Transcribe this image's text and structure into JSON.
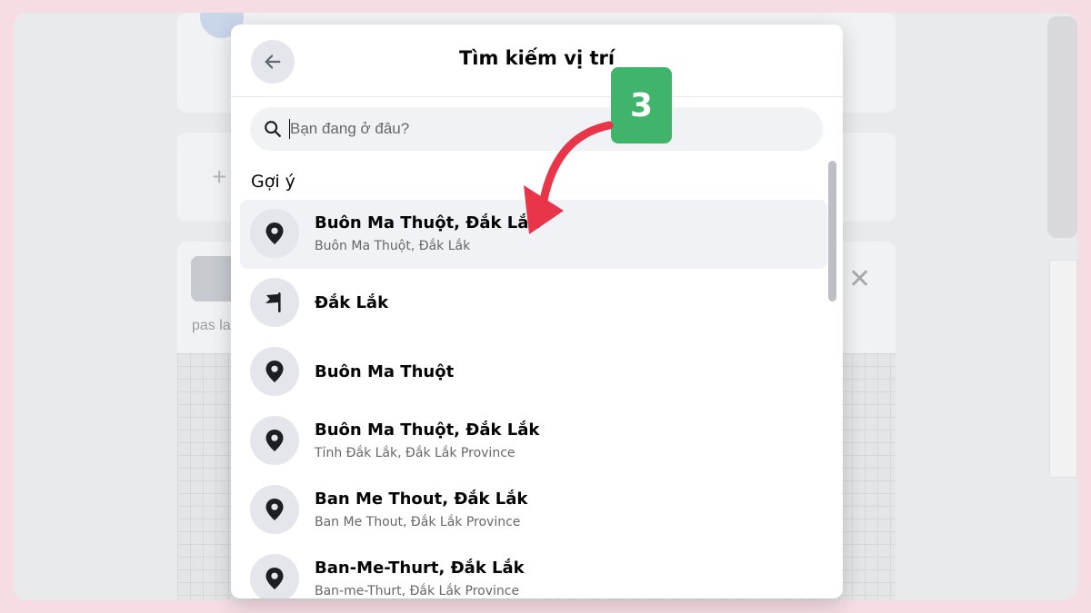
{
  "modal": {
    "title": "Tìm kiếm vị trí",
    "back_icon": "arrow-left-icon",
    "search": {
      "placeholder": "Bạn đang ở đâu?",
      "value": ""
    },
    "section_label": "Gợi ý",
    "suggestions": [
      {
        "icon": "map-pin-icon",
        "title": "Buôn Ma Thuột, Đắk Lắk",
        "subtitle": "Buôn Ma Thuột, Đắk Lắk",
        "active": true
      },
      {
        "icon": "flag-icon",
        "title": "Đắk Lắk",
        "subtitle": ""
      },
      {
        "icon": "map-pin-icon",
        "title": "Buôn Ma Thuột",
        "subtitle": ""
      },
      {
        "icon": "map-pin-icon",
        "title": "Buôn Ma Thuột, Đắk Lắk",
        "subtitle": "Tỉnh Đắk Lắk, Đắk Lắk Province"
      },
      {
        "icon": "map-pin-icon",
        "title": "Ban Me Thout, Đắk Lắk",
        "subtitle": "Ban Me Thout, Đắk Lắk Province"
      },
      {
        "icon": "map-pin-icon",
        "title": "Ban-Me-Thurt, Đắk Lắk",
        "subtitle": "Ban-me-Thurt, Đắk Lắk Province"
      }
    ]
  },
  "annotation": {
    "step": "3",
    "color": "#3fb46a",
    "arrow_color": "#e8354a"
  },
  "background": {
    "partial_text": "pas la"
  }
}
